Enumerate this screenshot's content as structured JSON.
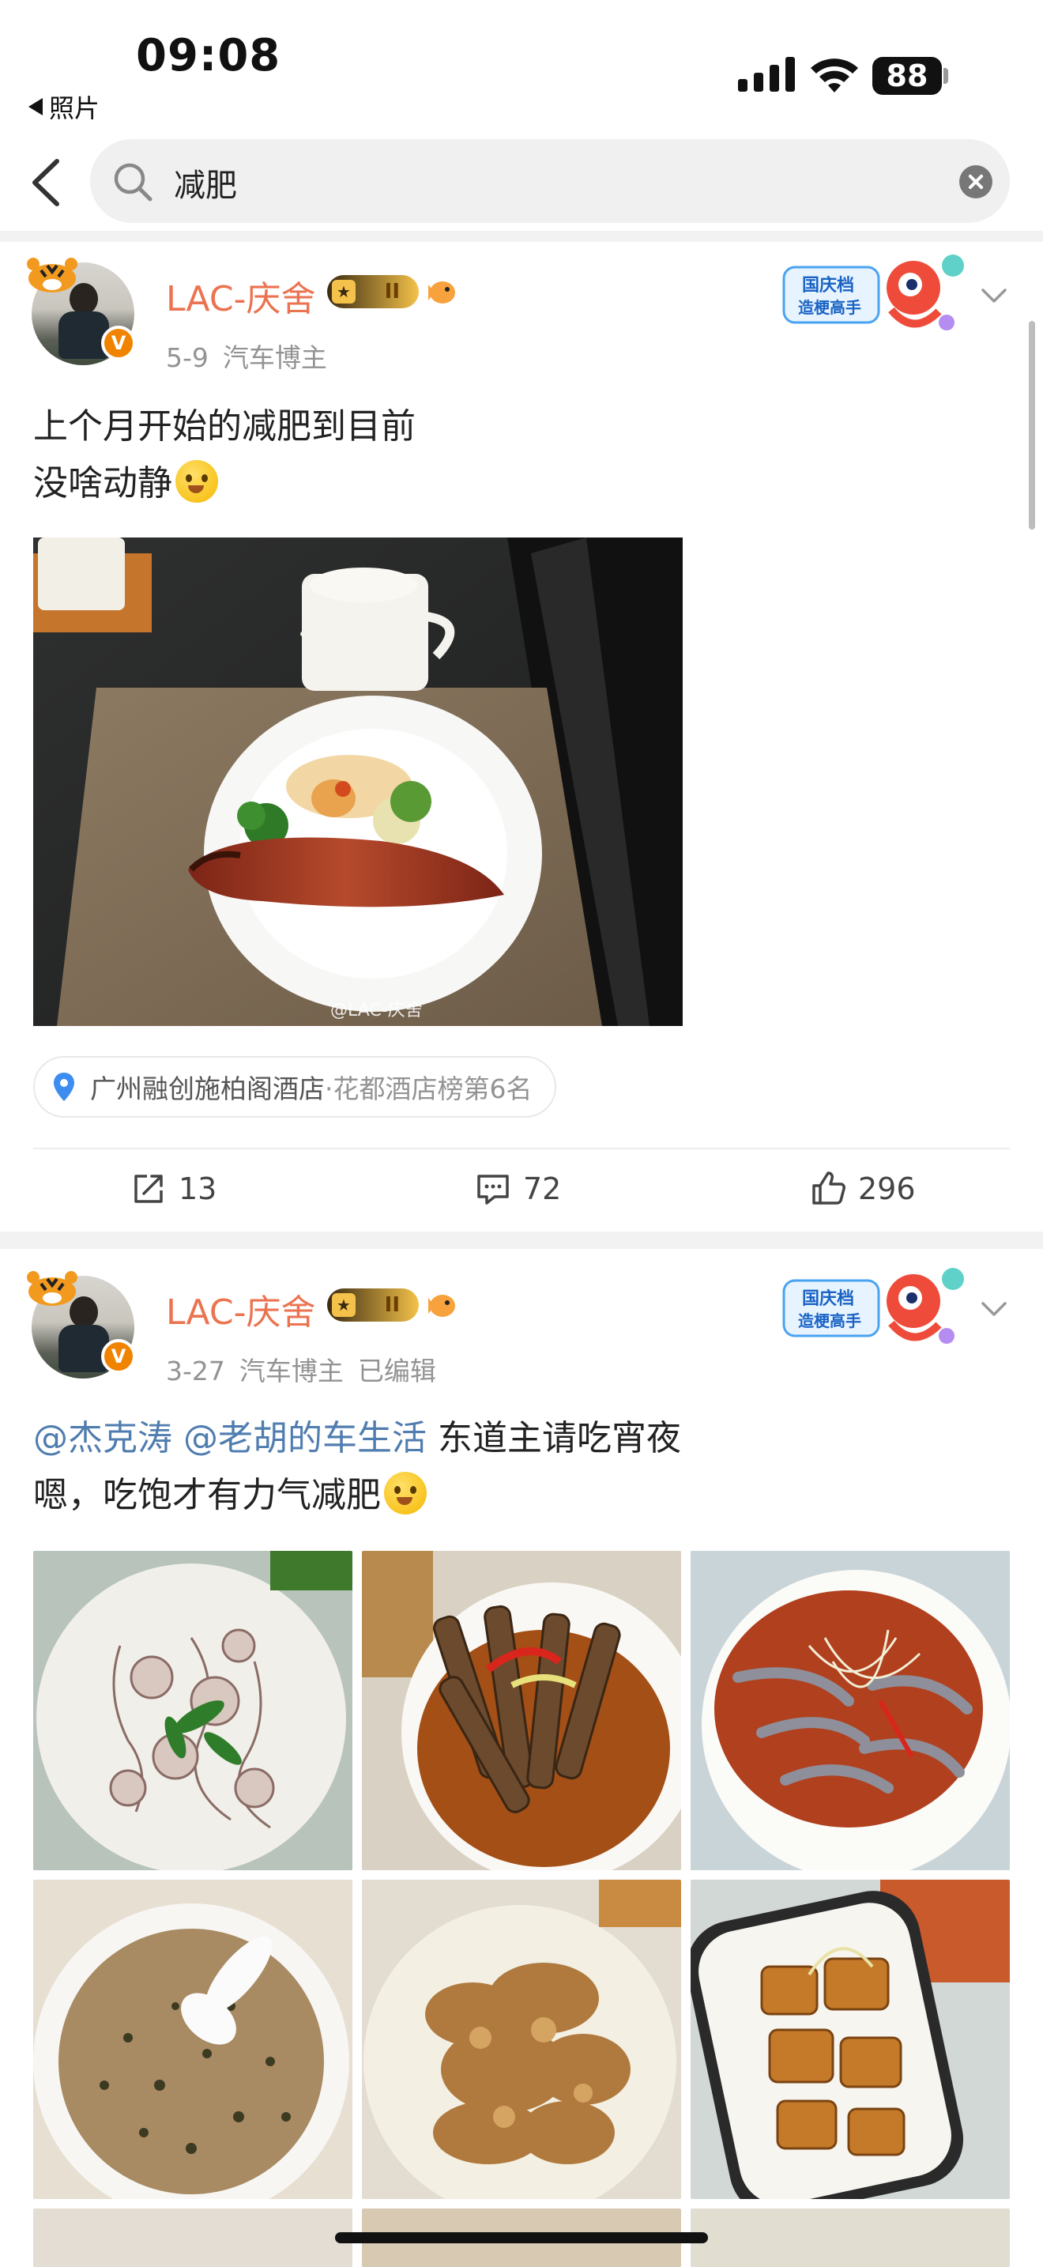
{
  "status_bar": {
    "time": "09:08",
    "back_app": "照片",
    "battery": "88"
  },
  "search": {
    "query": "减肥"
  },
  "posts": [
    {
      "username": "LAC-庆舍",
      "crown_level": "II",
      "date": "5-9",
      "role": "汽车博主",
      "edited": "",
      "text_lines": [
        "上个月开始的减肥到目前",
        "没啥动静"
      ],
      "image_watermark": "@LAC-庆舍",
      "location_name": "广州融创施柏阁酒店",
      "location_rank": "·花都酒店榜第6名",
      "reposts": "13",
      "comments": "72",
      "likes": "296"
    },
    {
      "username": "LAC-庆舍",
      "crown_level": "II",
      "date": "3-27",
      "role": "汽车博主",
      "edited": "已编辑",
      "mention_1": "@杰克涛",
      "mention_2": "@老胡的车生活",
      "text_line1_tail": " 东道主请吃宵夜",
      "text_line2": "嗯，吃饱才有力气减肥"
    }
  ],
  "promo_badge": {
    "line1": "国庆档",
    "line2": "造梗高手"
  },
  "colors": {
    "username": "#eb7350",
    "mention": "#507daf",
    "meta": "#939393",
    "badge": "#f08300"
  }
}
